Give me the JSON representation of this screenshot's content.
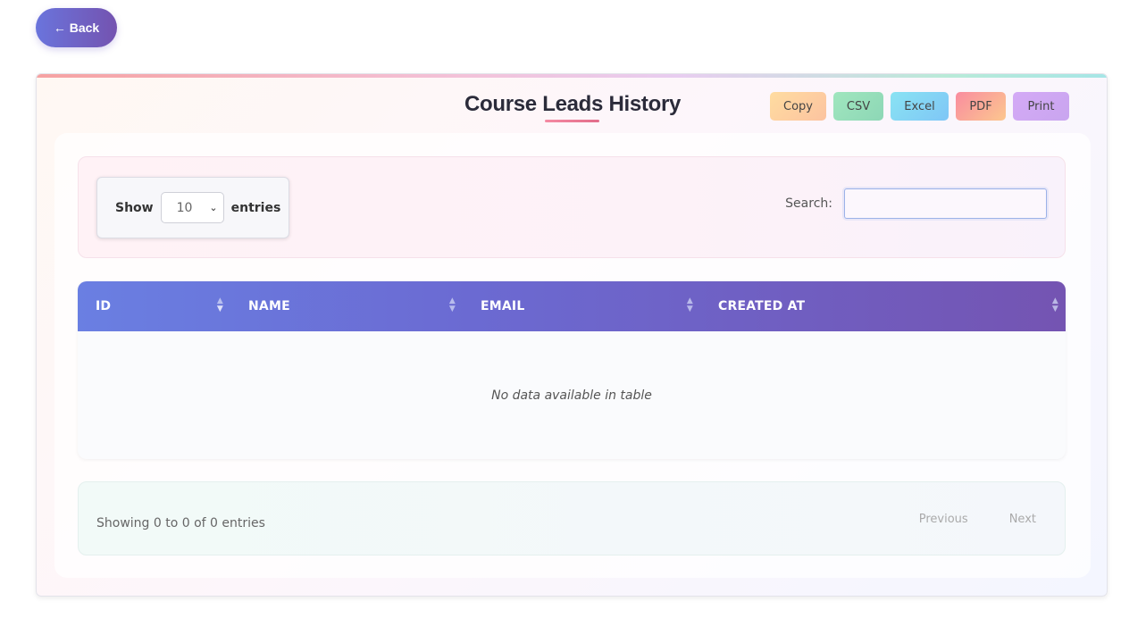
{
  "nav": {
    "back_label": "← Back"
  },
  "page": {
    "title": "Course Leads History"
  },
  "export_buttons": [
    "Copy",
    "CSV",
    "Excel",
    "PDF",
    "Print"
  ],
  "length_menu": {
    "show_label": "Show",
    "selected": "10",
    "entries_label": "entries"
  },
  "search": {
    "label": "Search:",
    "value": ""
  },
  "table": {
    "columns": [
      "ID",
      "NAME",
      "EMAIL",
      "CREATED AT"
    ],
    "empty_message": "No data available in table"
  },
  "footer": {
    "info": "Showing 0 to 0 of 0 entries",
    "previous_label": "Previous",
    "next_label": "Next"
  },
  "colors": {
    "accent_start": "#6a7fe2",
    "accent_end": "#7454b2",
    "title_underline": "#e26d8a"
  },
  "icons": {
    "sort": "sort-arrows-icon",
    "select_chevron": "chevron-down-icon"
  }
}
